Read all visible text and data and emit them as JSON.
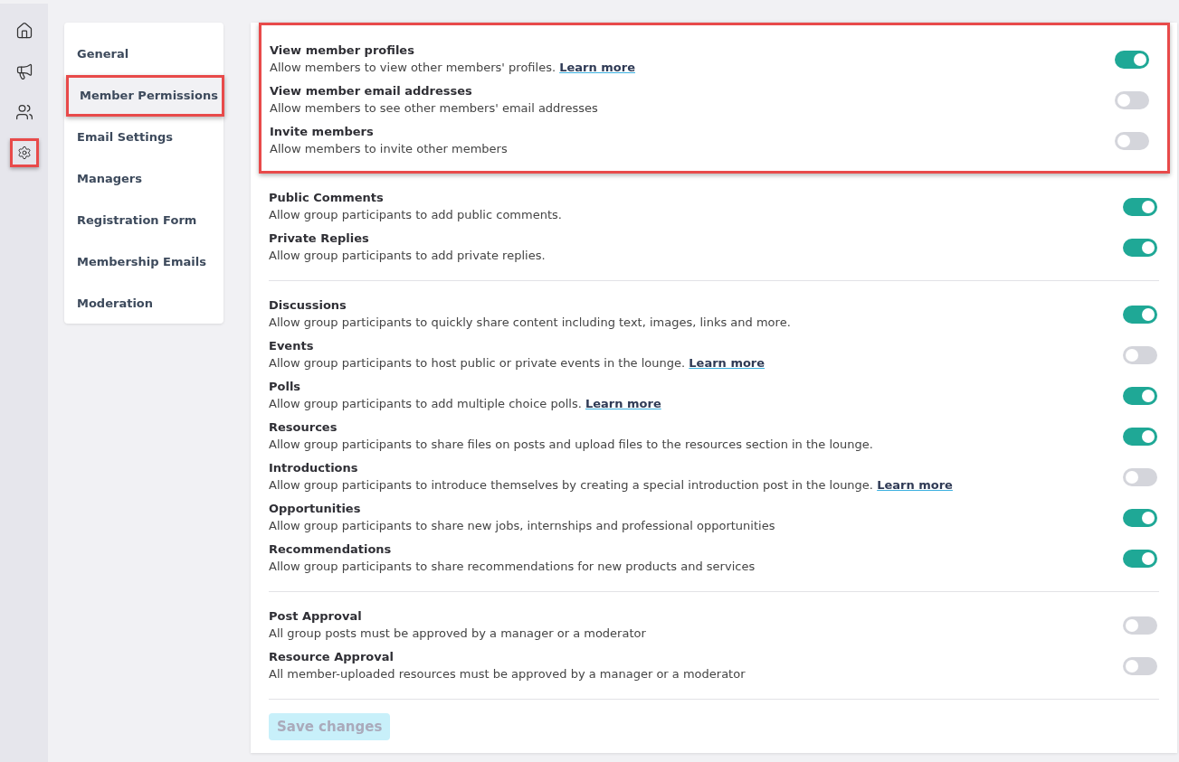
{
  "rail": [
    {
      "kind": "home",
      "selected": false,
      "highlighted": false
    },
    {
      "kind": "announce",
      "selected": false,
      "highlighted": false
    },
    {
      "kind": "people",
      "selected": false,
      "highlighted": false
    },
    {
      "kind": "config",
      "selected": true,
      "highlighted": true
    }
  ],
  "nav": [
    {
      "label": "General",
      "selected": false,
      "highlighted": false
    },
    {
      "label": "Member Permissions",
      "selected": true,
      "highlighted": true
    },
    {
      "label": "Email Settings",
      "selected": false,
      "highlighted": false
    },
    {
      "label": "Managers",
      "selected": false,
      "highlighted": false
    },
    {
      "label": "Registration Form",
      "selected": false,
      "highlighted": false
    },
    {
      "label": "Membership Emails",
      "selected": false,
      "highlighted": false
    },
    {
      "label": "Moderation",
      "selected": false,
      "highlighted": false
    }
  ],
  "sections": [
    {
      "highlighted": true,
      "settings": [
        {
          "title": "View member profiles",
          "description": "Allow members to view other members' profiles.",
          "link": "Learn more",
          "on": true
        },
        {
          "title": "View member email addresses",
          "description": "Allow members to see other members' email addresses",
          "on": false
        },
        {
          "title": "Invite members",
          "description": "Allow members to invite other members",
          "on": false
        }
      ]
    },
    {
      "highlighted": false,
      "settings": [
        {
          "title": "Public Comments",
          "description": "Allow group participants to add public comments.",
          "on": true
        },
        {
          "title": "Private Replies",
          "description": "Allow group participants to add private replies.",
          "on": true
        }
      ]
    },
    {
      "highlighted": false,
      "settings": [
        {
          "title": "Discussions",
          "description": "Allow group participants to quickly share content including text, images, links and more.",
          "on": true
        },
        {
          "title": "Events",
          "description": "Allow group participants to host public or private events in the lounge.",
          "link": "Learn more",
          "on": false
        },
        {
          "title": "Polls",
          "description": "Allow group participants to add multiple choice polls.",
          "link": "Learn more",
          "on": true
        },
        {
          "title": "Resources",
          "description": "Allow group participants to share files on posts and upload files to the resources section in the lounge.",
          "on": true
        },
        {
          "title": "Introductions",
          "description": "Allow group participants to introduce themselves by creating a special introduction post in the lounge.",
          "link": "Learn more",
          "on": false
        },
        {
          "title": "Opportunities",
          "description": "Allow group participants to share new jobs, internships and professional opportunities",
          "on": true
        },
        {
          "title": "Recommendations",
          "description": "Allow group participants to share recommendations for new products and services",
          "on": true
        }
      ]
    },
    {
      "highlighted": false,
      "settings": [
        {
          "title": "Post Approval",
          "description": "All group posts must be approved by a manager or a moderator",
          "on": false
        },
        {
          "title": "Resource Approval",
          "description": "All member-uploaded resources must be approved by a manager or a moderator",
          "on": false
        }
      ]
    }
  ],
  "save_button": {
    "label": "Save changes",
    "disabled": true
  }
}
